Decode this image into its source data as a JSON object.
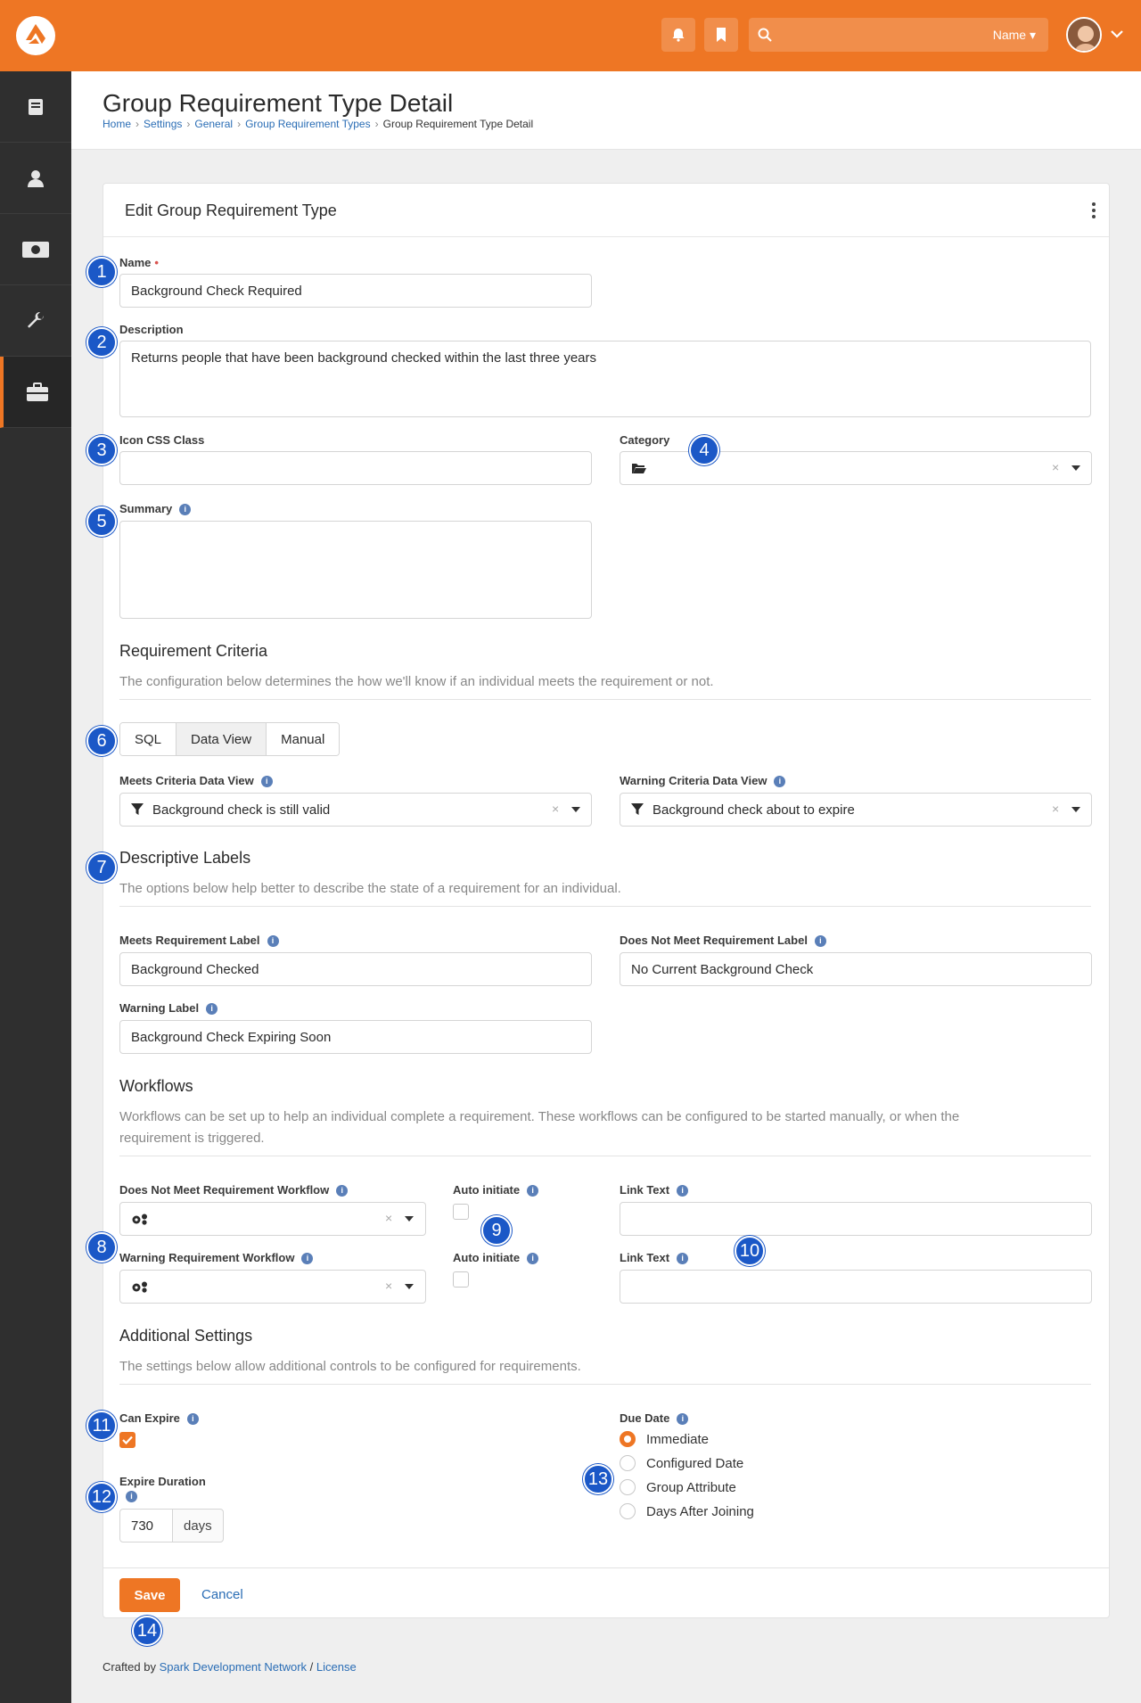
{
  "topbar": {
    "search_name_label": "Name",
    "icons": [
      "rock-logo-icon",
      "bell-icon",
      "bookmark-icon",
      "search-icon",
      "user-avatar",
      "chevron-down-icon"
    ],
    "accent_color": "#ee7624"
  },
  "sidebar": {
    "items": [
      "book-icon",
      "person-icon",
      "money-icon",
      "wrench-icon",
      "briefcase-icon"
    ],
    "active_index": 4
  },
  "header": {
    "title": "Group Requirement Type Detail",
    "breadcrumb": [
      "Home",
      "Settings",
      "General",
      "Group Requirement Types",
      "Group Requirement Type Detail"
    ]
  },
  "panel": {
    "title": "Edit Group Requirement Type"
  },
  "form": {
    "name": {
      "label": "Name",
      "value": "Background Check Required",
      "required": true
    },
    "description": {
      "label": "Description",
      "value": "Returns people that have been background checked within the last three years"
    },
    "icon_css": {
      "label": "Icon CSS Class",
      "value": ""
    },
    "category": {
      "label": "Category",
      "value": ""
    },
    "summary": {
      "label": "Summary",
      "value": ""
    }
  },
  "criteria": {
    "title": "Requirement Criteria",
    "desc": "The configuration below determines the how we'll know if an individual meets the requirement or not.",
    "tabs": [
      "SQL",
      "Data View",
      "Manual"
    ],
    "active_tab": "Data View",
    "meets_label": "Meets Criteria Data View",
    "meets_value": "Background check is still valid",
    "warning_label": "Warning Criteria Data View",
    "warning_value": "Background check about to expire"
  },
  "labels": {
    "title": "Descriptive Labels",
    "desc": "The options below help better to describe the state of a requirement for an individual.",
    "meets_label": "Meets Requirement Label",
    "meets_value": "Background Checked",
    "not_meets_label": "Does Not Meet Requirement Label",
    "not_meets_value": "No Current Background Check",
    "warning_label": "Warning Label",
    "warning_value": "Background Check Expiring Soon"
  },
  "workflows": {
    "title": "Workflows",
    "desc": "Workflows can be set up to help an individual complete a requirement. These workflows can be configured to be started manually, or when the requirement is triggered.",
    "not_meet_label": "Does Not Meet Requirement Workflow",
    "warning_label": "Warning Requirement Workflow",
    "auto_initiate_label": "Auto initiate",
    "link_text_label": "Link Text",
    "not_meet_auto": false,
    "warning_auto": false,
    "link_text_1": "",
    "link_text_2": ""
  },
  "additional": {
    "title": "Additional Settings",
    "desc": "The settings below allow additional controls to be configured for requirements.",
    "can_expire_label": "Can Expire",
    "can_expire": true,
    "expire_duration_label": "Expire Duration",
    "expire_duration_value": "730",
    "expire_duration_unit": "days",
    "due_date_label": "Due Date",
    "due_date_options": [
      "Immediate",
      "Configured Date",
      "Group Attribute",
      "Days After Joining"
    ],
    "due_date_selected": "Immediate"
  },
  "actions": {
    "save": "Save",
    "cancel": "Cancel"
  },
  "callouts": [
    "1",
    "2",
    "3",
    "4",
    "5",
    "6",
    "7",
    "8",
    "9",
    "10",
    "11",
    "12",
    "13",
    "14"
  ],
  "footer": {
    "prefix": "Crafted by ",
    "org": "Spark Development Network",
    "sep": " / ",
    "license": "License"
  }
}
